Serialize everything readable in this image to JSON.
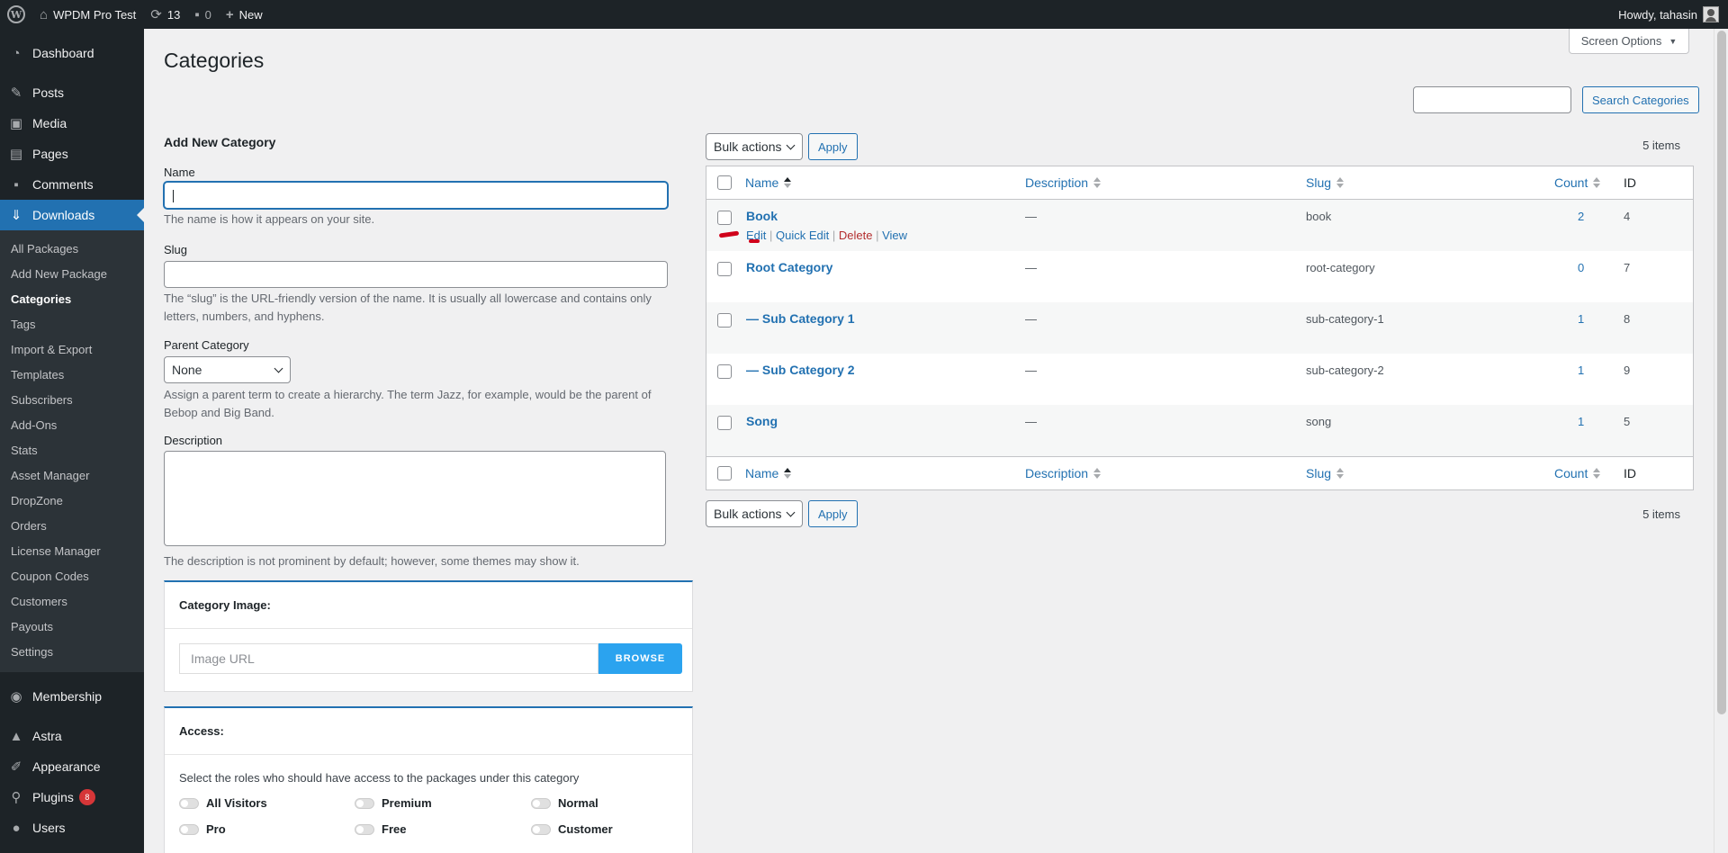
{
  "adminbar": {
    "site_name": "WPDM Pro Test",
    "updates_count": "13",
    "comments_count": "0",
    "new_label": "New",
    "howdy": "Howdy, tahasin"
  },
  "sidebar": {
    "top": [
      {
        "label": "Dashboard",
        "icon": "dashboard-icon"
      },
      {
        "label": "Posts",
        "icon": "pin-icon"
      },
      {
        "label": "Media",
        "icon": "media-icon"
      },
      {
        "label": "Pages",
        "icon": "pages-icon"
      },
      {
        "label": "Comments",
        "icon": "comments-icon"
      },
      {
        "label": "Downloads",
        "icon": "download-icon"
      }
    ],
    "downloads_submenu": [
      "All Packages",
      "Add New Package",
      "Categories",
      "Tags",
      "Import & Export",
      "Templates",
      "Subscribers",
      "Add-Ons",
      "Stats",
      "Asset Manager",
      "DropZone",
      "Orders",
      "License Manager",
      "Coupon Codes",
      "Customers",
      "Payouts",
      "Settings"
    ],
    "bottom": [
      {
        "label": "Membership"
      },
      {
        "label": "Astra"
      },
      {
        "label": "Appearance"
      },
      {
        "label": "Plugins",
        "badge": "8"
      },
      {
        "label": "Users"
      }
    ]
  },
  "page": {
    "title": "Categories",
    "screen_options": "Screen Options",
    "search_button": "Search Categories"
  },
  "form": {
    "heading": "Add New Category",
    "name_label": "Name",
    "name_help": "The name is how it appears on your site.",
    "slug_label": "Slug",
    "slug_help_1": "The “slug” is the URL-friendly version of the name. It is usually all lowercase and contains only",
    "slug_help_2": "letters, numbers, and hyphens.",
    "parent_label": "Parent Category",
    "parent_value": "None",
    "parent_help_1": "Assign a parent term to create a hierarchy. The term Jazz, for example, would be the parent of",
    "parent_help_2": "Bebop and Big Band.",
    "description_label": "Description",
    "description_help": "The description is not prominent by default; however, some themes may show it.",
    "category_image_title": "Category Image:",
    "image_url_placeholder": "Image URL",
    "browse_label": "BROWSE",
    "access_title": "Access:",
    "access_desc": "Select the roles who should have access to the packages under this category",
    "roles": [
      "All Visitors",
      "Premium",
      "Normal",
      "Pro",
      "Free",
      "Customer"
    ]
  },
  "table": {
    "bulk_label": "Bulk actions",
    "apply_label": "Apply",
    "items_count": "5 items",
    "columns": {
      "name": "Name",
      "description": "Description",
      "slug": "Slug",
      "count": "Count",
      "id": "ID"
    },
    "rows": [
      {
        "name": "Book",
        "description": "—",
        "slug": "book",
        "count": "2",
        "id": "4"
      },
      {
        "name": "Root Category",
        "description": "—",
        "slug": "root-category",
        "count": "0",
        "id": "7"
      },
      {
        "name": "— Sub Category 1",
        "description": "—",
        "slug": "sub-category-1",
        "count": "1",
        "id": "8"
      },
      {
        "name": "— Sub Category 2",
        "description": "—",
        "slug": "sub-category-2",
        "count": "1",
        "id": "9"
      },
      {
        "name": "Song",
        "description": "—",
        "slug": "song",
        "count": "1",
        "id": "5"
      }
    ],
    "row_actions": {
      "edit": "Edit",
      "quick_edit": "Quick Edit",
      "delete": "Delete",
      "view": "View"
    }
  }
}
